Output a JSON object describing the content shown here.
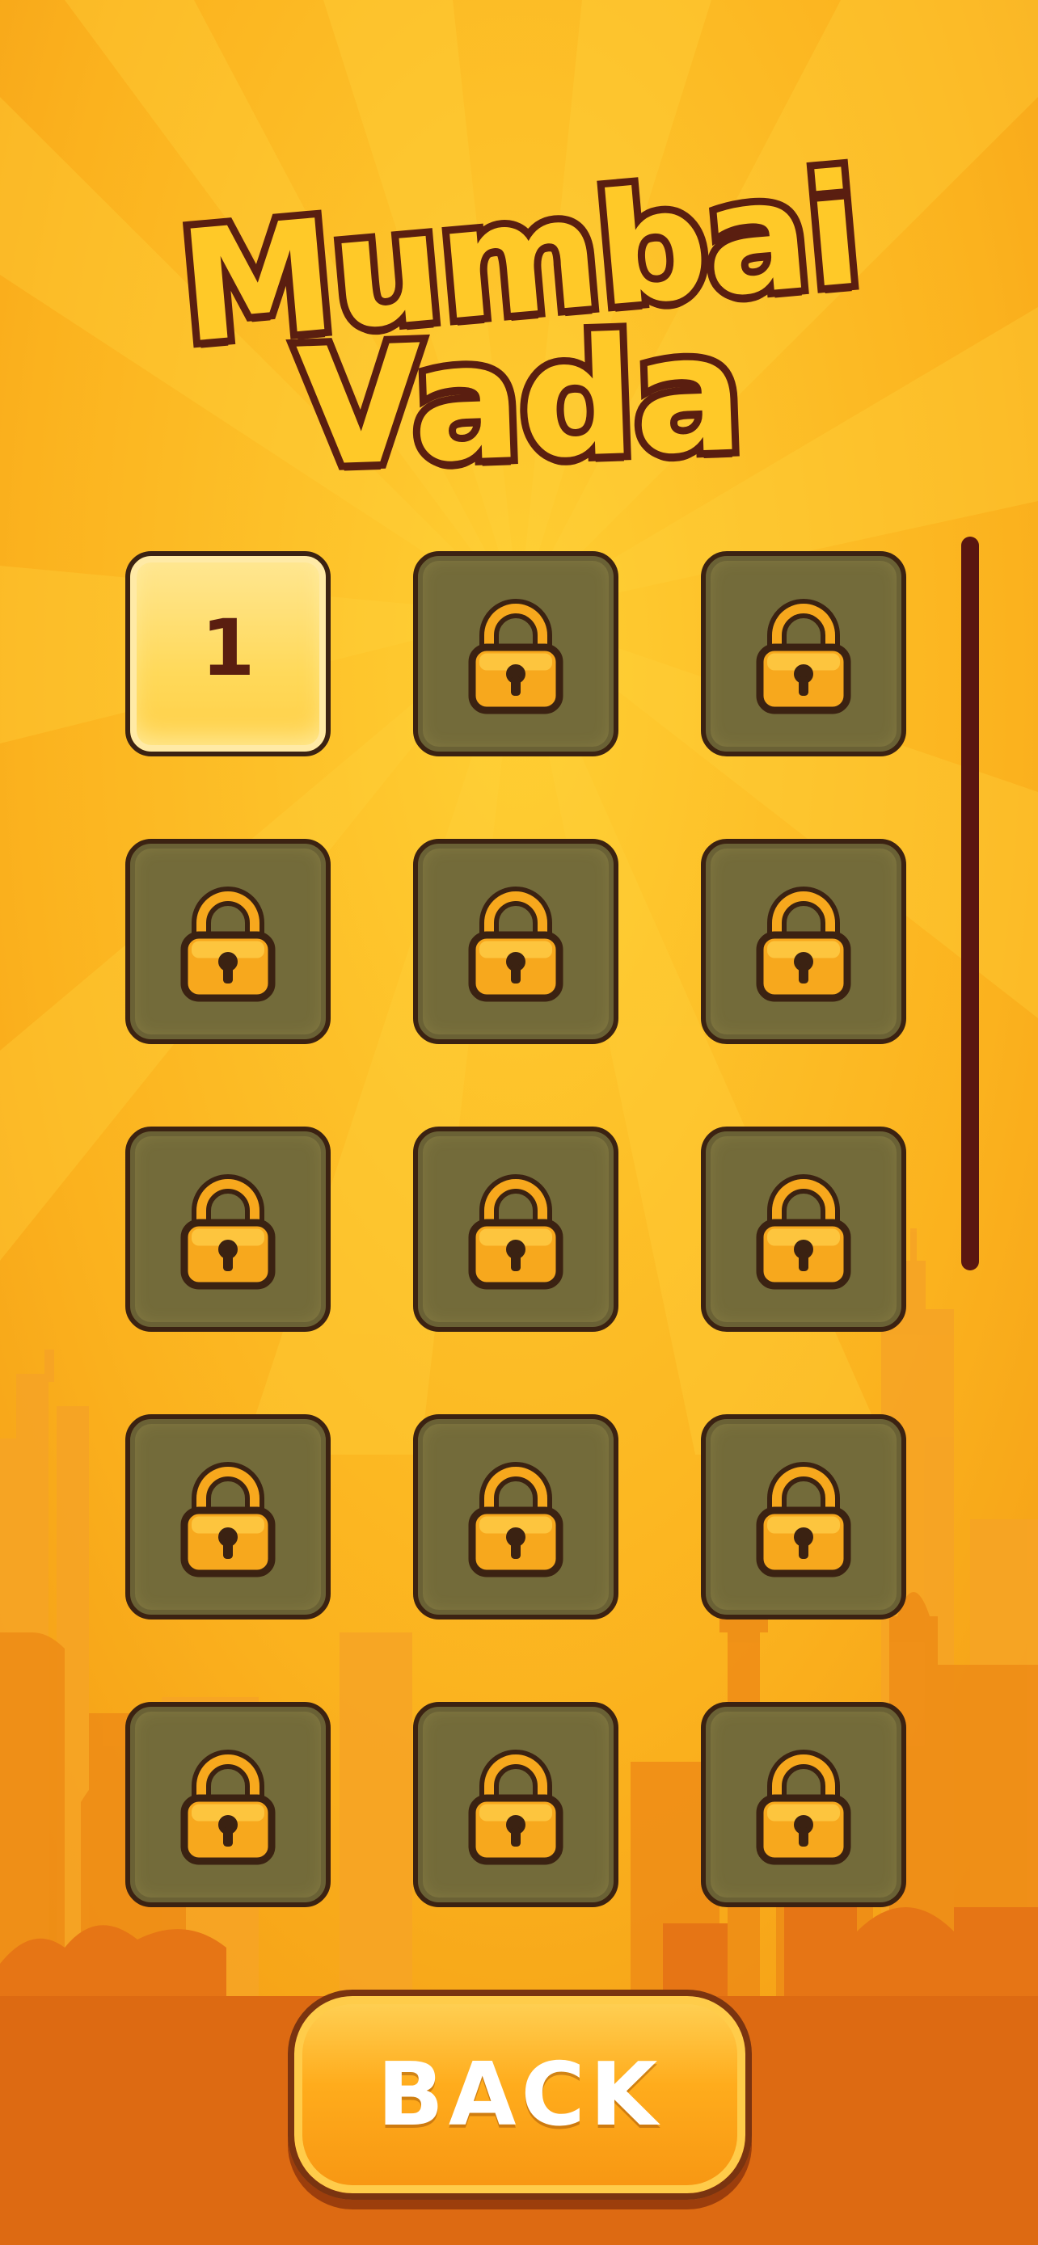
{
  "title": {
    "line1": "Mumbai",
    "line2": "Vada"
  },
  "levels": [
    {
      "label": "1",
      "locked": false
    },
    {
      "label": "",
      "locked": true
    },
    {
      "label": "",
      "locked": true
    },
    {
      "label": "",
      "locked": true
    },
    {
      "label": "",
      "locked": true
    },
    {
      "label": "",
      "locked": true
    },
    {
      "label": "",
      "locked": true
    },
    {
      "label": "",
      "locked": true
    },
    {
      "label": "",
      "locked": true
    },
    {
      "label": "",
      "locked": true
    },
    {
      "label": "",
      "locked": true
    },
    {
      "label": "",
      "locked": true
    },
    {
      "label": "",
      "locked": true
    },
    {
      "label": "",
      "locked": true
    },
    {
      "label": "",
      "locked": true
    }
  ],
  "lock_icon": "padlock-icon",
  "back_button": {
    "label": "BACK"
  },
  "colors": {
    "background": "#f9b21e",
    "outline": "#5a1e10",
    "locked_tile": "#736b3a",
    "unlocked_tile": "#ffdd6a",
    "button": "#ffac1c"
  }
}
